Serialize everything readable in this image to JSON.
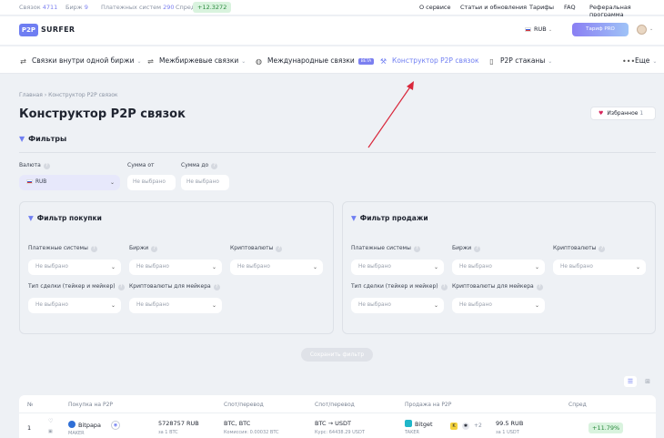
{
  "topbar": {
    "links_label": "Связок",
    "links_value": "4711",
    "exchanges_label": "Бирж",
    "exchanges_value": "9",
    "payments_label": "Платежных систем",
    "payments_value": "290",
    "spread_label": "Спред",
    "spread_value": "+12.3272",
    "nav": [
      "О сервисе",
      "Статьи и обновления",
      "Тарифы",
      "FAQ",
      "Реферальная программа"
    ]
  },
  "header": {
    "logo_mark": "P2P",
    "logo_text": "SURFER",
    "currency": "RUB",
    "tariff_button": "Тариф PRO"
  },
  "menu": {
    "items": [
      {
        "label": "Связки внутри одной биржи",
        "icon": "arbitrage-icon"
      },
      {
        "label": "Межбиржевые связки",
        "icon": "exchange-icon"
      },
      {
        "label": "Международные связки",
        "icon": "globe-icon",
        "badge": "BETA"
      },
      {
        "label": "Конструктор P2P связок",
        "icon": "constructor-icon",
        "active": true
      },
      {
        "label": "P2P стаканы",
        "icon": "orderbook-icon"
      }
    ],
    "more_label": "Еще"
  },
  "breadcrumb": "Главная › Конструктор P2P связок",
  "page_title": "Конструктор P2P связок",
  "favorites": {
    "label": "Избранное",
    "count": "1"
  },
  "filters": {
    "heading": "Фильтры",
    "currency_label": "Валюта",
    "currency_value": "RUB",
    "sum_from_label": "Сумма от",
    "sum_to_label": "Сумма до",
    "sum_from_placeholder": "Не выбрано",
    "sum_to_placeholder": "Не выбрано"
  },
  "buy_filter": {
    "heading": "Фильтр покупки",
    "payment_label": "Платежные системы",
    "exchanges_label": "Биржи",
    "crypto_label": "Криптовалюты",
    "deal_type_label": "Тип сделки (тейкер и мейкер)",
    "maker_crypto_label": "Криптовалюты для мейкера",
    "placeholder": "Не выбрано"
  },
  "sell_filter": {
    "heading": "Фильтр продажи",
    "payment_label": "Платежные системы",
    "exchanges_label": "Биржи",
    "crypto_label": "Криптовалюты",
    "deal_type_label": "Тип сделки (тейкер и мейкер)",
    "maker_crypto_label": "Криптовалюты для мейкера",
    "placeholder": "Не выбрано"
  },
  "save_filter": "Сохранить фильтр",
  "table": {
    "headers": [
      "№",
      "Покупка на P2P",
      "Спот/перевод",
      "Спот/перевод",
      "Продажа на P2P",
      "Спред"
    ],
    "row": {
      "num": "1",
      "buy_exchange": "Bitpapa",
      "buy_role": "MAKER",
      "buy_price": "5728757 RUB",
      "buy_per": "за 1 BTC",
      "spot1": "BTC, BTC",
      "spot1_fee": "Комиссия: 0.00032 BTC",
      "spot2": "BTC → USDT",
      "spot2_rate": "Курс: 64438.29 USDT",
      "sell_exchange": "Bitget",
      "sell_role": "TAKER",
      "sell_more": "+2",
      "sell_price": "99.5 RUB",
      "sell_per": "за 1 USDT",
      "spread": "+11.79%"
    }
  },
  "colors": {
    "accent": "#6f7ef2",
    "spread_bg": "#d9f3de",
    "spread_fg": "#2b8a3e",
    "annotation_arrow": "#d9273b"
  }
}
